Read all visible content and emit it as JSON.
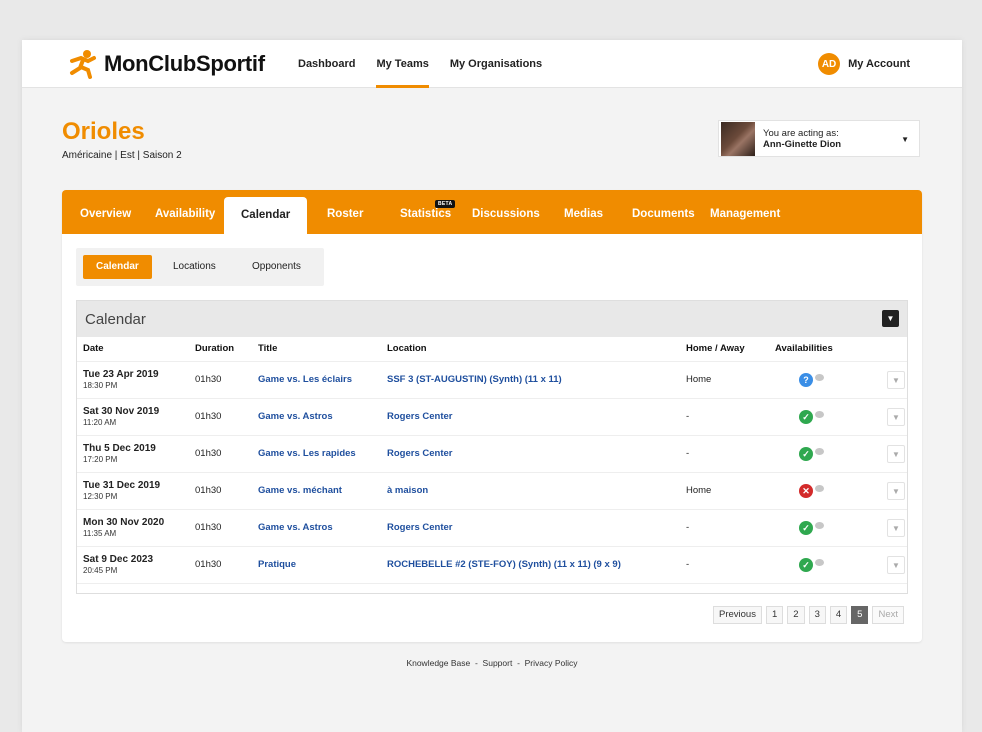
{
  "app": {
    "logo_text": "MonClubSportif"
  },
  "topnav": {
    "items": [
      "Dashboard",
      "My Teams",
      "My Organisations"
    ],
    "active": "My Teams"
  },
  "account": {
    "initials": "AD",
    "label": "My Account"
  },
  "team": {
    "name": "Orioles",
    "subtitle": "Américaine | Est | Saison 2"
  },
  "acting": {
    "label": "You are acting as:",
    "name": "Ann-Ginette Dion"
  },
  "tabs": {
    "items": [
      "Overview",
      "Availability",
      "Calendar",
      "Roster",
      "Statistics",
      "Discussions",
      "Medias",
      "Documents",
      "Management"
    ],
    "active": "Calendar",
    "beta_badge": "BETA"
  },
  "subtabs": {
    "items": [
      "Calendar",
      "Locations",
      "Opponents"
    ],
    "active": "Calendar"
  },
  "calendar": {
    "title": "Calendar",
    "columns": [
      "Date",
      "Duration",
      "Title",
      "Location",
      "Home / Away",
      "Availabilities"
    ],
    "rows": [
      {
        "date": "Tue 23 Apr 2019",
        "time": "18:30 PM",
        "duration": "01h30",
        "title": "Game vs. Les éclairs",
        "location": "SSF 3 (ST-AUGUSTIN) (Synth) (11 x 11)",
        "home_away": "Home",
        "status": "unknown"
      },
      {
        "date": "Sat 30 Nov 2019",
        "time": "11:20 AM",
        "duration": "01h30",
        "title": "Game vs. Astros",
        "location": "Rogers Center",
        "home_away": "-",
        "status": "available"
      },
      {
        "date": "Thu 5 Dec 2019",
        "time": "17:20 PM",
        "duration": "01h30",
        "title": "Game vs. Les rapides",
        "location": "Rogers Center",
        "home_away": "-",
        "status": "available"
      },
      {
        "date": "Tue 31 Dec 2019",
        "time": "12:30 PM",
        "duration": "01h30",
        "title": "Game vs. méchant",
        "location": "à maison",
        "home_away": "Home",
        "status": "unavailable"
      },
      {
        "date": "Mon 30 Nov 2020",
        "time": "11:35 AM",
        "duration": "01h30",
        "title": "Game vs. Astros",
        "location": "Rogers Center",
        "home_away": "-",
        "status": "available"
      },
      {
        "date": "Sat 9 Dec 2023",
        "time": "20:45 PM",
        "duration": "01h30",
        "title": "Pratique",
        "location": "ROCHEBELLE #2 (STE-FOY) (Synth) (11 x 11) (9 x 9)",
        "home_away": "-",
        "status": "available"
      }
    ]
  },
  "pagination": {
    "previous": "Previous",
    "pages": [
      "1",
      "2",
      "3",
      "4",
      "5"
    ],
    "current": "5",
    "next": "Next"
  },
  "footer": {
    "links": [
      "Knowledge Base",
      "Support",
      "Privacy Policy"
    ],
    "separator": "-"
  },
  "colors": {
    "brand": "#f08c00",
    "link": "#1f4f9e",
    "ok": "#2fa84f",
    "no": "#d32a2a",
    "unknown": "#3a8ee6"
  }
}
